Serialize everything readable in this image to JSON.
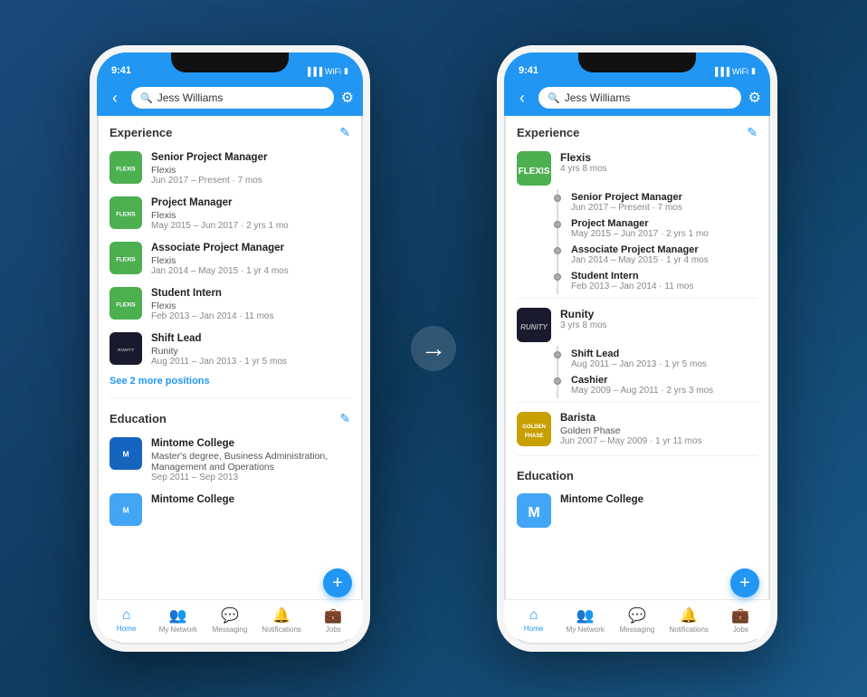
{
  "phones": {
    "left": {
      "status_time": "9:41",
      "search_placeholder": "Jess Williams",
      "sections": {
        "experience": {
          "title": "Experience",
          "items": [
            {
              "logo": "flexis",
              "title": "Senior Project Manager",
              "company": "Flexis",
              "date": "Jun 2017 – Present · 7 mos"
            },
            {
              "logo": "flexis",
              "title": "Project Manager",
              "company": "Flexis",
              "date": "May 2015 – Jun 2017 · 2 yrs 1 mo"
            },
            {
              "logo": "flexis",
              "title": "Associate Project Manager",
              "company": "Flexis",
              "date": "Jan 2014 – May 2015 · 1 yr 4 mos"
            },
            {
              "logo": "flexis",
              "title": "Student Intern",
              "company": "Flexis",
              "date": "Feb 2013 – Jan 2014 · 11 mos"
            },
            {
              "logo": "runity",
              "title": "Shift Lead",
              "company": "Runity",
              "date": "Aug 2011 – Jan 2013 · 1 yr 5 mos"
            }
          ],
          "see_more": "See 2 more positions"
        },
        "education": {
          "title": "Education",
          "items": [
            {
              "logo": "mintome",
              "name": "Mintome College",
              "degree": "Master's degree, Business Administration, Management and Operations",
              "date": "Sep 2011 – Sep 2013"
            },
            {
              "logo": "mintome",
              "name": "Mintome College",
              "degree": "",
              "date": ""
            }
          ]
        }
      },
      "nav": [
        "Home",
        "My Network",
        "Messaging",
        "Notifications",
        "Jobs"
      ]
    },
    "right": {
      "status_time": "9:41",
      "search_placeholder": "Jess Williams",
      "sections": {
        "experience": {
          "title": "Experience",
          "groups": [
            {
              "logo": "flexis",
              "company": "Flexis",
              "duration": "4 yrs 8 mos",
              "roles": [
                {
                  "title": "Senior Project Manager",
                  "date": "Jun 2017 – Present · 7 mos"
                },
                {
                  "title": "Project Manager",
                  "date": "May 2015 – Jun 2017 · 2 yrs 1 mo"
                },
                {
                  "title": "Associate Project Manager",
                  "date": "Jan 2014 – May 2015 · 1 yr 4 mos"
                },
                {
                  "title": "Student Intern",
                  "date": "Feb 2013 – Jan 2014 · 11 mos"
                }
              ]
            },
            {
              "logo": "runity",
              "company": "Runity",
              "duration": "3 yrs 8 mos",
              "roles": [
                {
                  "title": "Shift Lead",
                  "date": "Aug 2011 – Jan 2013 · 1 yr 5 mos"
                },
                {
                  "title": "Cashier",
                  "date": "May 2009 – Aug 2011 · 2 yrs 3 mos"
                }
              ]
            },
            {
              "logo": "golden",
              "company": "Barista",
              "companyName": "Golden Phase",
              "duration": "Jun 2007 – May 2009 · 1 yr 11 mos",
              "roles": []
            }
          ]
        },
        "education": {
          "title": "Education",
          "items": [
            {
              "logo": "mintome",
              "name": "Mintome College"
            }
          ]
        }
      },
      "nav": [
        "Home",
        "My Network",
        "Messaging",
        "Notifications",
        "Jobs"
      ]
    }
  },
  "arrow": "→"
}
